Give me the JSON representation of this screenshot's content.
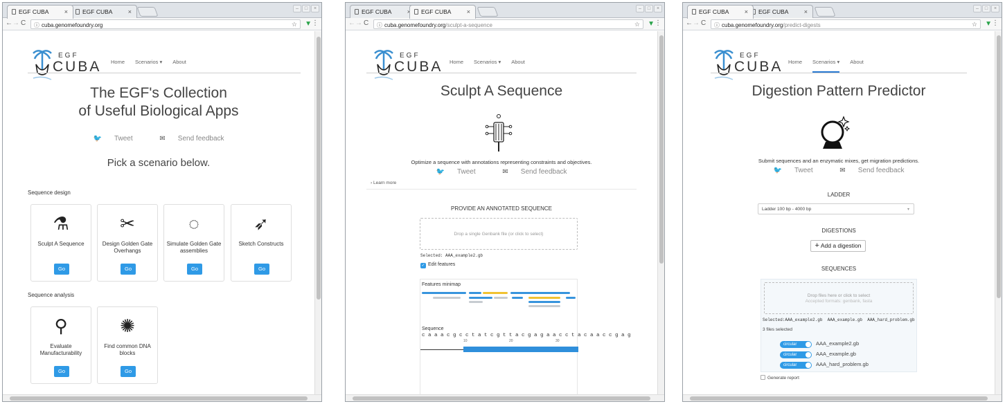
{
  "windows": [
    {
      "tabs": [
        {
          "title": "EGF CUBA",
          "close": "×"
        },
        {
          "title": "EGF CUBA",
          "close": "×"
        }
      ],
      "url_host": "cuba.genomefoundry.org",
      "url_path": "",
      "logo_top": "EGF",
      "logo_bottom": "CUBA",
      "nav": [
        "Home",
        "Scenarios ▾",
        "About"
      ],
      "heading_line1": "The EGF's Collection",
      "heading_line2": "of Useful Biological Apps",
      "tweet": "Tweet",
      "feedback": "Send feedback",
      "subheading": "Pick a scenario below.",
      "section_design": "Sequence design",
      "section_analysis": "Sequence analysis",
      "go_label": "Go",
      "design_cards": [
        {
          "title": "Sculpt A Sequence",
          "icon": "sculpt-icon",
          "glyph": "⚗"
        },
        {
          "title": "Design Golden Gate Overhangs",
          "icon": "overhangs-icon",
          "glyph": "✂"
        },
        {
          "title": "Simulate Golden Gate assemblies",
          "icon": "assembly-icon",
          "glyph": "◌"
        },
        {
          "title": "Sketch Constructs",
          "icon": "rocket-icon",
          "glyph": "➶"
        }
      ],
      "analysis_cards": [
        {
          "title": "Evaluate Manufacturability",
          "icon": "magnifier-icon",
          "glyph": "⚲"
        },
        {
          "title": "Find common DNA blocks",
          "icon": "ball-icon",
          "glyph": "✺"
        }
      ]
    },
    {
      "tabs": [
        {
          "title": "EGF CUBA",
          "close": "×"
        },
        {
          "title": "EGF CUBA",
          "close": "×"
        }
      ],
      "url_host": "cuba.genomefoundry.org",
      "url_path": "/sculpt-a-sequence",
      "logo_top": "EGF",
      "logo_bottom": "CUBA",
      "nav": [
        "Home",
        "Scenarios ▾",
        "About"
      ],
      "heading": "Sculpt A Sequence",
      "description": "Optimize a sequence with annotations representing constraints and objectives.",
      "tweet": "Tweet",
      "feedback": "Send feedback",
      "learn_more": "Learn more",
      "provide_label": "PROVIDE AN ANNOTATED SEQUENCE",
      "drop_text": "Drop a single Genbank file (or click to select)",
      "selected_label": "Selected:",
      "selected_file": "AAA_example2.gb",
      "edit_features": "Edit features",
      "features_minimap": "Features minimap",
      "sequence_label": "Sequence",
      "sequence": "c a a a c g c c t a t c g t t a c g a g a a c c t a c a a c c g a g",
      "ticks": [
        "10",
        "20",
        "30"
      ]
    },
    {
      "tabs": [
        {
          "title": "EGF CUBA",
          "close": "×"
        },
        {
          "title": "EGF CUBA",
          "close": "×"
        }
      ],
      "url_host": "cuba.genomefoundry.org",
      "url_path": "/predict-digests",
      "logo_top": "EGF",
      "logo_bottom": "CUBA",
      "nav": [
        "Home",
        "Scenarios ▾",
        "About"
      ],
      "heading": "Digestion Pattern Predictor",
      "description": "Submit sequences and an enzymatic mixes, get migration predictions.",
      "tweet": "Tweet",
      "feedback": "Send feedback",
      "ladder_label": "LADDER",
      "ladder_value": "Ladder 100 bp - 4000 bp",
      "digestions_label": "DIGESTIONS",
      "add_digestion": "Add a digestion",
      "sequences_label": "SEQUENCES",
      "drop_line1": "Drop files here or click to select",
      "drop_line2": "Accepted formats: genbank, fasta",
      "selected_label": "Selected:",
      "selected_files": "AAA_example2.gb  AAA_example.gb  AAA_hard_problem.gb",
      "files_selected": "3 files selected",
      "toggle_label": "circular",
      "files": [
        "AAA_example2.gb",
        "AAA_example.gb",
        "AAA_hard_problem.gb"
      ],
      "generate_report": "Generate report"
    }
  ]
}
